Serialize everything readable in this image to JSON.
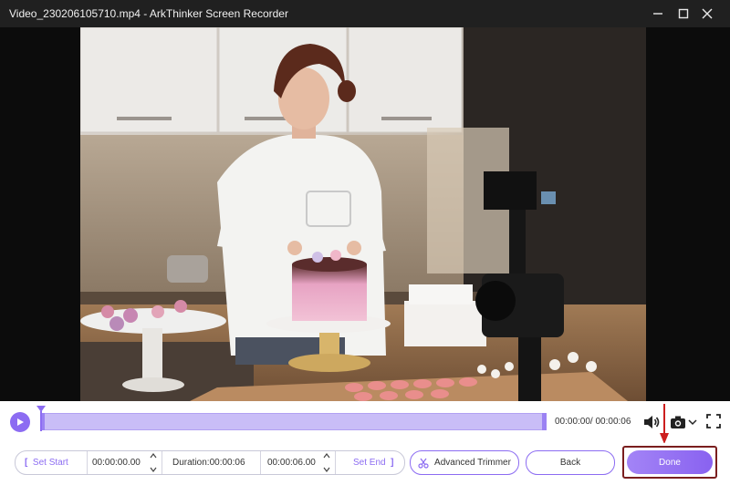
{
  "window": {
    "title": "Video_230206105710.mp4  -  ArkThinker Screen Recorder",
    "controls": [
      "minimize-icon",
      "maximize-icon",
      "close-icon"
    ]
  },
  "player": {
    "time_readout": "00:00:00/ 00:00:06",
    "playhead_fraction": 0.0,
    "icons": [
      "play-icon",
      "volume-icon",
      "camera-icon",
      "chevron-down-icon",
      "fullscreen-icon"
    ]
  },
  "trimmer": {
    "set_start_label": "Set Start",
    "start_time": "00:00:00.00",
    "duration_label": "Duration:00:00:06",
    "end_time": "00:00:06.00",
    "set_end_label": "Set End",
    "advanced_label": "Advanced Trimmer",
    "back_label": "Back",
    "done_label": "Done"
  },
  "colors": {
    "accent": "#8c6cf2",
    "track": "#c9bdf7",
    "titlebar": "#202020",
    "highlight_border": "#7a1e1e",
    "arrow": "#cc1f1f"
  }
}
